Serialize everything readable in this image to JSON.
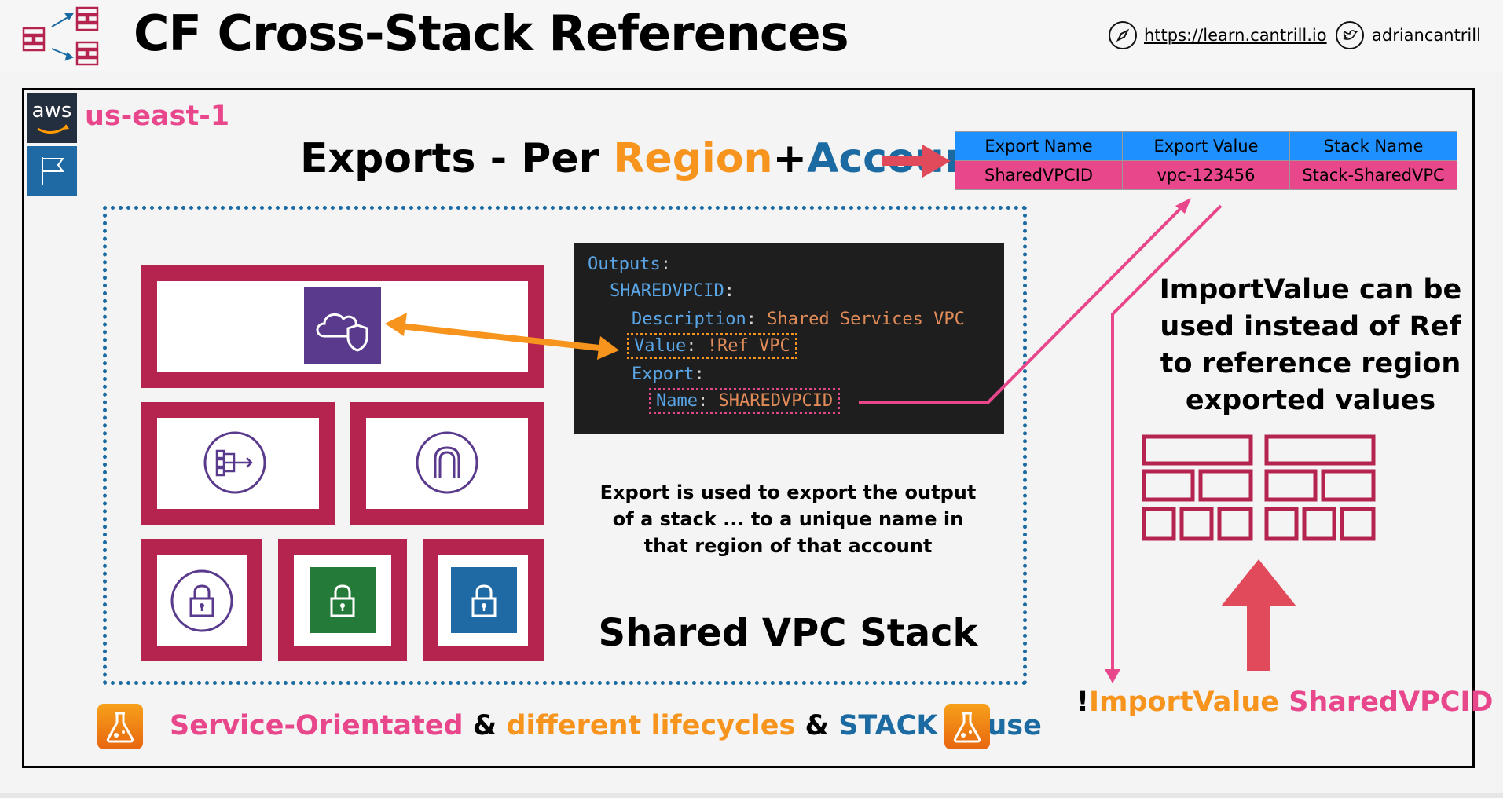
{
  "header": {
    "title": "CF Cross-Stack References",
    "site_link": "https://learn.cantrill.io",
    "twitter_handle": "adriancantrill"
  },
  "region": {
    "aws_logo_text": "aws",
    "label": "us-east-1"
  },
  "exports_heading": {
    "prefix": "Exports - Per ",
    "region": "Region",
    "plus": "+",
    "account": "Account",
    "colors": {
      "region": "#f7941d",
      "account": "#1b6aa1"
    }
  },
  "export_table": {
    "headers": [
      "Export Name",
      "Export Value",
      "Stack Name"
    ],
    "row": [
      "SharedVPCID",
      "vpc-123456",
      "Stack-SharedVPC"
    ]
  },
  "code": {
    "l1_key": "Outputs",
    "l2_key": "SHAREDVPCID",
    "l3_key": "Description",
    "l3_val": "Shared Services VPC",
    "l4_key": "Value",
    "l4_val": "!Ref VPC",
    "l5_key": "Export",
    "l6_key": "Name",
    "l6_val": "SHAREDVPCID",
    "colon": ":"
  },
  "notes": {
    "export_line1": "Export is used to export the output",
    "export_line2": "of a stack ... to a unique name in",
    "export_line3": "that region of that account",
    "stack_title": "Shared VPC Stack",
    "import_line1": "ImportValue can be",
    "import_line2": "used instead of Ref",
    "import_line3": "to reference region",
    "import_line4": "exported values"
  },
  "import_cmd": {
    "bang": "!",
    "func": "ImportValue",
    "space": " ",
    "name": "SharedVPCID"
  },
  "bottom": {
    "part1": "Service-Orientated",
    "amp1": " & ",
    "part2": "different lifecycles",
    "amp2": " & ",
    "part3": "STACK Reuse"
  },
  "colors": {
    "pink": "#e8478b",
    "orange": "#f7941d",
    "blue": "#1b6aa1",
    "crimson": "#b5244f",
    "table_header": "#1e90ff",
    "arrow_red": "#e04a5a"
  },
  "icons": [
    "cloudformation-stacks-icon",
    "compass-icon",
    "twitter-icon",
    "aws-logo",
    "region-flag-icon",
    "vpc-shield-icon",
    "nat-gateway-icon",
    "internet-gateway-icon",
    "padlock-icon",
    "flask-icon"
  ]
}
